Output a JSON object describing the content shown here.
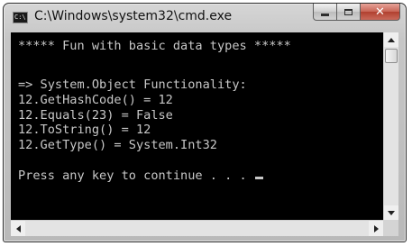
{
  "window": {
    "title": "C:\\Windows\\system32\\cmd.exe",
    "app_icon_text": "C:\\",
    "buttons": {
      "minimize": "minimize-icon",
      "maximize": "maximize-icon",
      "close": "close-icon",
      "close_glyph": "✕"
    }
  },
  "console": {
    "lines": [
      "***** Fun with basic data types *****",
      "",
      "=> System.Object Functionality:",
      "12.GetHashCode() = 12",
      "12.Equals(23) = False",
      "12.ToString() = 12",
      "12.GetType() = System.Int32",
      "",
      "Press any key to continue . . . "
    ],
    "text_color": "#c8c8c8",
    "background": "#000000"
  },
  "scrollbars": {
    "vertical_position": 0,
    "horizontal_position": 0
  }
}
